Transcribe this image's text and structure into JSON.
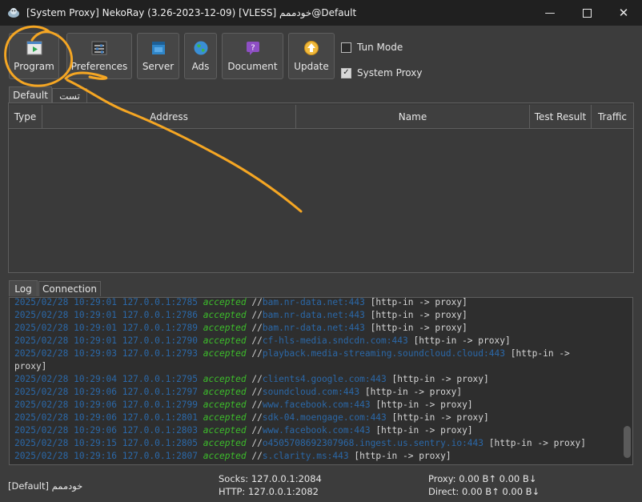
{
  "window": {
    "title": "[System Proxy] NekoRay (3.26-2023-12-09) [VLESS] خودممم@Default"
  },
  "toolbar": {
    "program": "Program",
    "preferences": "Preferences",
    "server": "Server",
    "ads": "Ads",
    "document": "Document",
    "update": "Update"
  },
  "toggles": {
    "tun_mode": "Tun Mode",
    "system_proxy": "System Proxy",
    "system_proxy_checked": "✓"
  },
  "groups": {
    "default_tab": "Default",
    "second_tab": "تست"
  },
  "table": {
    "columns": [
      "Type",
      "Address",
      "Name",
      "Test Result",
      "Traffic"
    ]
  },
  "bottom_tabs": {
    "log": "Log",
    "connection": "Connection"
  },
  "log": [
    {
      "ts": "2025/02/28 10:29:01 127.0.0.1:2785",
      "status": "accepted",
      "sep": "//",
      "dest": "bam.nr-data.net:443",
      "route": " [http-in -> proxy]"
    },
    {
      "ts": "2025/02/28 10:29:01 127.0.0.1:2786",
      "status": "accepted",
      "sep": "//",
      "dest": "bam.nr-data.net:443",
      "route": " [http-in -> proxy]"
    },
    {
      "ts": "2025/02/28 10:29:01 127.0.0.1:2789",
      "status": "accepted",
      "sep": "//",
      "dest": "bam.nr-data.net:443",
      "route": " [http-in -> proxy]"
    },
    {
      "ts": "2025/02/28 10:29:01 127.0.0.1:2790",
      "status": "accepted",
      "sep": "//",
      "dest": "cf-hls-media.sndcdn.com:443",
      "route": " [http-in -> proxy]"
    },
    {
      "ts": "2025/02/28 10:29:03 127.0.0.1:2793",
      "status": "accepted",
      "sep": "//",
      "dest": "playback.media-streaming.soundcloud.cloud:443",
      "route": " [http-in ->"
    },
    {
      "ts": "",
      "status": "",
      "sep": "",
      "dest": "",
      "route": "proxy]"
    },
    {
      "ts": "2025/02/28 10:29:04 127.0.0.1:2795",
      "status": "accepted",
      "sep": "//",
      "dest": "clients4.google.com:443",
      "route": " [http-in -> proxy]"
    },
    {
      "ts": "2025/02/28 10:29:06 127.0.0.1:2797",
      "status": "accepted",
      "sep": "//",
      "dest": "soundcloud.com:443",
      "route": " [http-in -> proxy]"
    },
    {
      "ts": "2025/02/28 10:29:06 127.0.0.1:2799",
      "status": "accepted",
      "sep": "//",
      "dest": "www.facebook.com:443",
      "route": " [http-in -> proxy]"
    },
    {
      "ts": "2025/02/28 10:29:06 127.0.0.1:2801",
      "status": "accepted",
      "sep": "//",
      "dest": "sdk-04.moengage.com:443",
      "route": " [http-in -> proxy]"
    },
    {
      "ts": "2025/02/28 10:29:06 127.0.0.1:2803",
      "status": "accepted",
      "sep": "//",
      "dest": "www.facebook.com:443",
      "route": " [http-in -> proxy]"
    },
    {
      "ts": "2025/02/28 10:29:15 127.0.0.1:2805",
      "status": "accepted",
      "sep": "//",
      "dest": "o4505708692307968.ingest.us.sentry.io:443",
      "route": " [http-in -> proxy]"
    },
    {
      "ts": "2025/02/28 10:29:16 127.0.0.1:2807",
      "status": "accepted",
      "sep": "//",
      "dest": "s.clarity.ms:443",
      "route": " [http-in -> proxy]"
    }
  ],
  "status": {
    "profile": "[Default] خودممم",
    "socks": "Socks: 127.0.0.1:2084",
    "http": "HTTP: 127.0.0.1:2082",
    "proxy": "Proxy: 0.00 B↑ 0.00 B↓",
    "direct": "Direct: 0.00 B↑ 0.00 B↓"
  },
  "colors": {
    "annotation": "#f5a623",
    "log_time": "#2b68a8",
    "log_accepted": "#3dbd2b"
  }
}
